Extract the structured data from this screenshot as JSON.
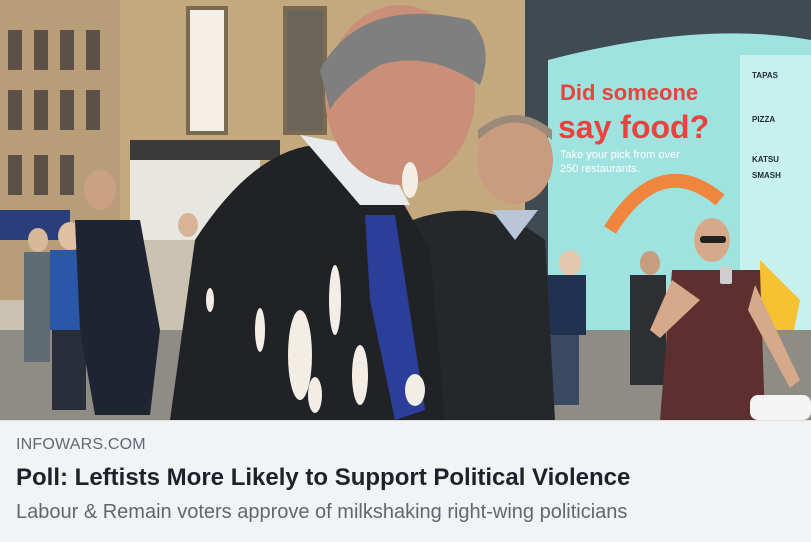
{
  "link_preview": {
    "domain": "INFOWARS.COM",
    "title": "Poll: Leftists More Likely to Support Political Violence",
    "description": "Labour & Remain voters approve of milkshaking right-wing politicians"
  },
  "photo": {
    "storefront_headline_line1": "Did someone",
    "storefront_headline_line2": "say food?",
    "storefront_small_line1": "Take your pick from over",
    "storefront_small_line2": "250 restaurants.",
    "brand_list": [
      "TAPAS",
      "",
      "PIZZA",
      "",
      "KATSU",
      "",
      "SMASH",
      "",
      "",
      ""
    ]
  },
  "colors": {
    "card_background": "#f2f3f5",
    "domain_text": "#606770",
    "title_text": "#1d2129",
    "storefront_red": "#e8433f",
    "storefront_teal": "#9fe3e0"
  }
}
